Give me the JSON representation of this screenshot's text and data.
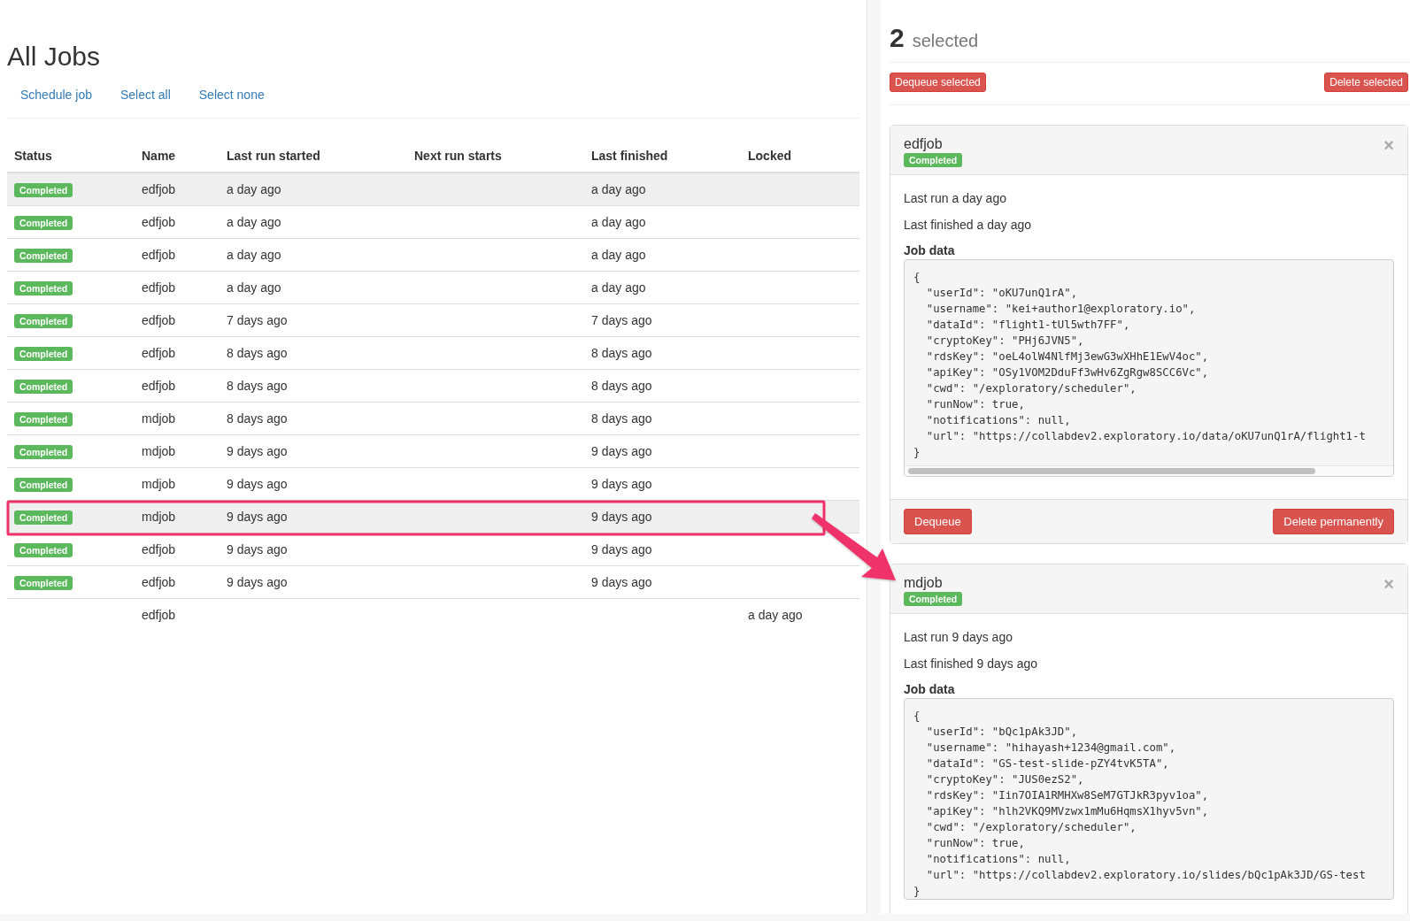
{
  "left": {
    "title": "All Jobs",
    "actions": [
      "Schedule job",
      "Select all",
      "Select none"
    ],
    "table": {
      "columns": [
        "Status",
        "Name",
        "Last run started",
        "Next run starts",
        "Last finished",
        "Locked"
      ],
      "rows": [
        {
          "status": "Completed",
          "name": "edfjob",
          "last_run_started": "a day ago",
          "last_finished": "a day ago",
          "selected": true
        },
        {
          "status": "Completed",
          "name": "edfjob",
          "last_run_started": "a day ago",
          "last_finished": "a day ago",
          "selected": false
        },
        {
          "status": "Completed",
          "name": "edfjob",
          "last_run_started": "a day ago",
          "last_finished": "a day ago",
          "selected": false
        },
        {
          "status": "Completed",
          "name": "edfjob",
          "last_run_started": "a day ago",
          "last_finished": "a day ago",
          "selected": false
        },
        {
          "status": "Completed",
          "name": "edfjob",
          "last_run_started": "7 days ago",
          "last_finished": "7 days ago",
          "selected": false
        },
        {
          "status": "Completed",
          "name": "edfjob",
          "last_run_started": "8 days ago",
          "last_finished": "8 days ago",
          "selected": false
        },
        {
          "status": "Completed",
          "name": "edfjob",
          "last_run_started": "8 days ago",
          "last_finished": "8 days ago",
          "selected": false
        },
        {
          "status": "Completed",
          "name": "mdjob",
          "last_run_started": "8 days ago",
          "last_finished": "8 days ago",
          "selected": false
        },
        {
          "status": "Completed",
          "name": "mdjob",
          "last_run_started": "9 days ago",
          "last_finished": "9 days ago",
          "selected": false
        },
        {
          "status": "Completed",
          "name": "mdjob",
          "last_run_started": "9 days ago",
          "last_finished": "9 days ago",
          "selected": false
        },
        {
          "status": "Completed",
          "name": "mdjob",
          "last_run_started": "9 days ago",
          "last_finished": "9 days ago",
          "selected": true
        },
        {
          "status": "Completed",
          "name": "edfjob",
          "last_run_started": "9 days ago",
          "last_finished": "9 days ago",
          "selected": false
        },
        {
          "status": "Completed",
          "name": "edfjob",
          "last_run_started": "9 days ago",
          "last_finished": "9 days ago",
          "selected": false
        },
        {
          "name": "edfjob",
          "locked": "a day ago",
          "selected": false
        }
      ]
    }
  },
  "right": {
    "count": "2",
    "count_label": "selected",
    "dequeue_selected": "Dequeue selected",
    "delete_selected": "Delete selected",
    "cards": [
      {
        "name": "edfjob",
        "status": "Completed",
        "close": "×",
        "last_run": "Last run a day ago",
        "last_finished": "Last finished a day ago",
        "data_label": "Job data",
        "lines": [
          "{",
          "  \"userId\": \"oKU7unQ1rA\",",
          "  \"username\": \"kei+author1@exploratory.io\",",
          "  \"dataId\": \"flight1-tUl5wth7FF\",",
          "  \"cryptoKey\": \"PHj6JVN5\",",
          "  \"rdsKey\": \"oeL4olW4NlfMj3ewG3wXHhE1EwV4oc\",",
          "  \"apiKey\": \"OSy1VOM2DduFf3wHv6ZgRgw8SCC6Vc\",",
          "  \"cwd\": \"/exploratory/scheduler\",",
          "  \"runNow\": true,",
          "  \"notifications\": null,",
          "  \"url\": \"https://collabdev2.exploratory.io/data/oKU7unQ1rA/flight1-t",
          "}"
        ],
        "dequeue": "Dequeue",
        "delete": "Delete permanently"
      },
      {
        "name": "mdjob",
        "status": "Completed",
        "close": "×",
        "last_run": "Last run 9 days ago",
        "last_finished": "Last finished 9 days ago",
        "data_label": "Job data",
        "lines": [
          "{",
          "  \"userId\": \"bQc1pAk3JD\",",
          "  \"username\": \"hihayash+1234@gmail.com\",",
          "  \"dataId\": \"GS-test-slide-pZY4tvK5TA\",",
          "  \"cryptoKey\": \"JUS0ezS2\",",
          "  \"rdsKey\": \"Iin7OIA1RMHXw8SeM7GTJkR3pyv1oa\",",
          "  \"apiKey\": \"hlh2VKQ9MVzwx1mMu6HqmsX1hyv5vn\",",
          "  \"cwd\": \"/exploratory/scheduler\",",
          "  \"runNow\": true,",
          "  \"notifications\": null,",
          "  \"url\": \"https://collabdev2.exploratory.io/slides/bQc1pAk3JD/GS-test",
          "}"
        ]
      }
    ]
  }
}
